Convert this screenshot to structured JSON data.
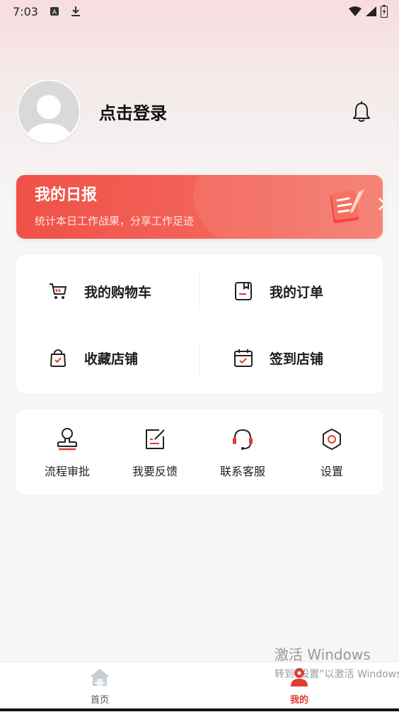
{
  "status_bar": {
    "time": "7:03"
  },
  "profile": {
    "login_label": "点击登录"
  },
  "daily_report": {
    "title": "我的日报",
    "subtitle": "统计本日工作战果，分享工作足迹"
  },
  "shortcuts": [
    {
      "label": "我的购物车",
      "icon": "shopping-cart-icon"
    },
    {
      "label": "我的订单",
      "icon": "order-icon"
    },
    {
      "label": "收藏店铺",
      "icon": "favorite-shop-icon"
    },
    {
      "label": "签到店铺",
      "icon": "calendar-check-icon"
    }
  ],
  "tools": [
    {
      "label": "流程审批",
      "icon": "stamp-icon"
    },
    {
      "label": "我要反馈",
      "icon": "feedback-icon"
    },
    {
      "label": "联系客服",
      "icon": "headset-icon"
    },
    {
      "label": "设置",
      "icon": "gear-icon"
    }
  ],
  "watermark": {
    "line1": "激活 Windows",
    "line2": "转到“设置”以激活 Windows。"
  },
  "bottom_nav": {
    "home": "首页",
    "mine": "我的"
  },
  "colors": {
    "accent": "#e23b30",
    "banner": "#f05449"
  }
}
